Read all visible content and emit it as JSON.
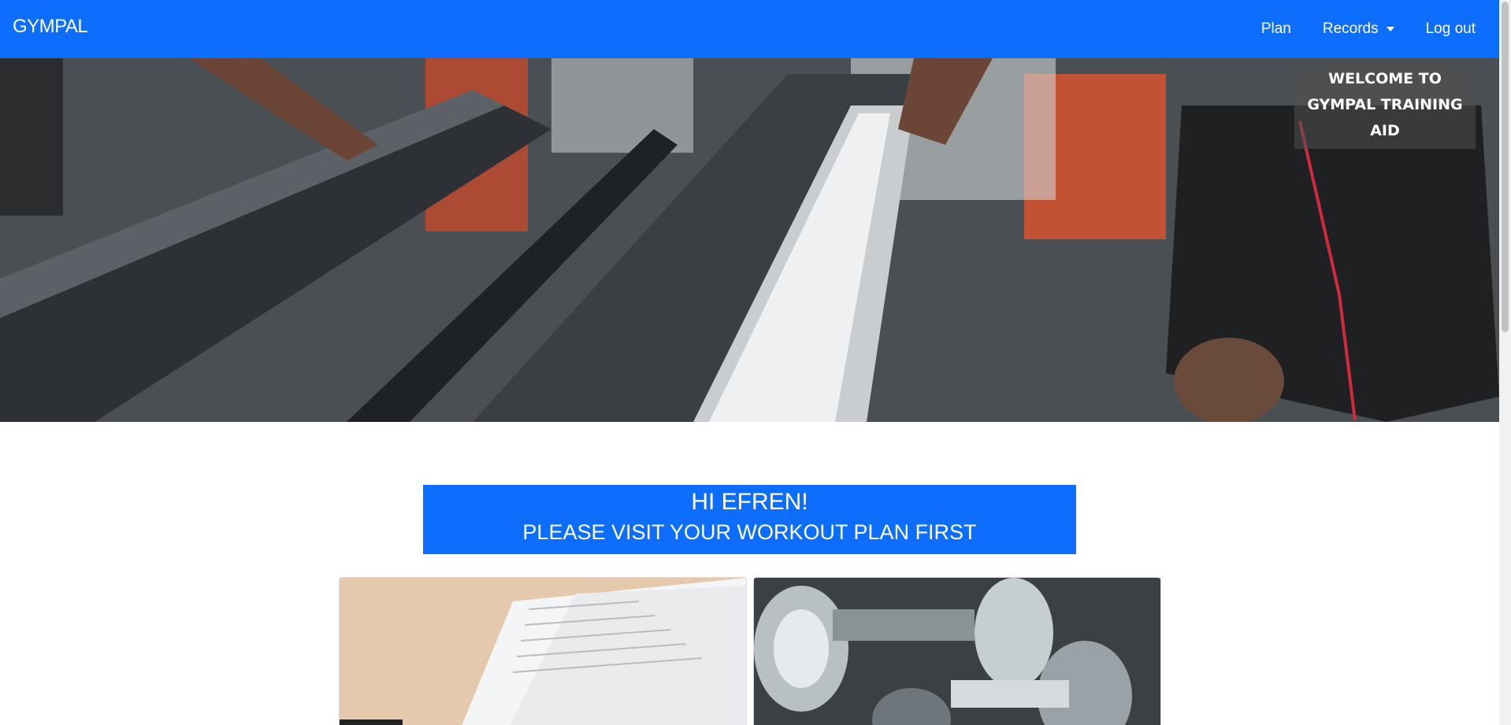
{
  "navbar": {
    "brand": "GYMPAL",
    "links": [
      {
        "label": "Plan"
      },
      {
        "label": "Records"
      },
      {
        "label": "Log out"
      }
    ]
  },
  "hero": {
    "welcome": "WELCOME TO GYMPAL TRAINING AID"
  },
  "greeting": {
    "line1": "HI EFREN!",
    "line2": "PLEASE VISIT YOUR WORKOUT PLAN FIRST"
  },
  "colors": {
    "primary": "#0d6efd",
    "text_on_primary": "#ffffff"
  }
}
